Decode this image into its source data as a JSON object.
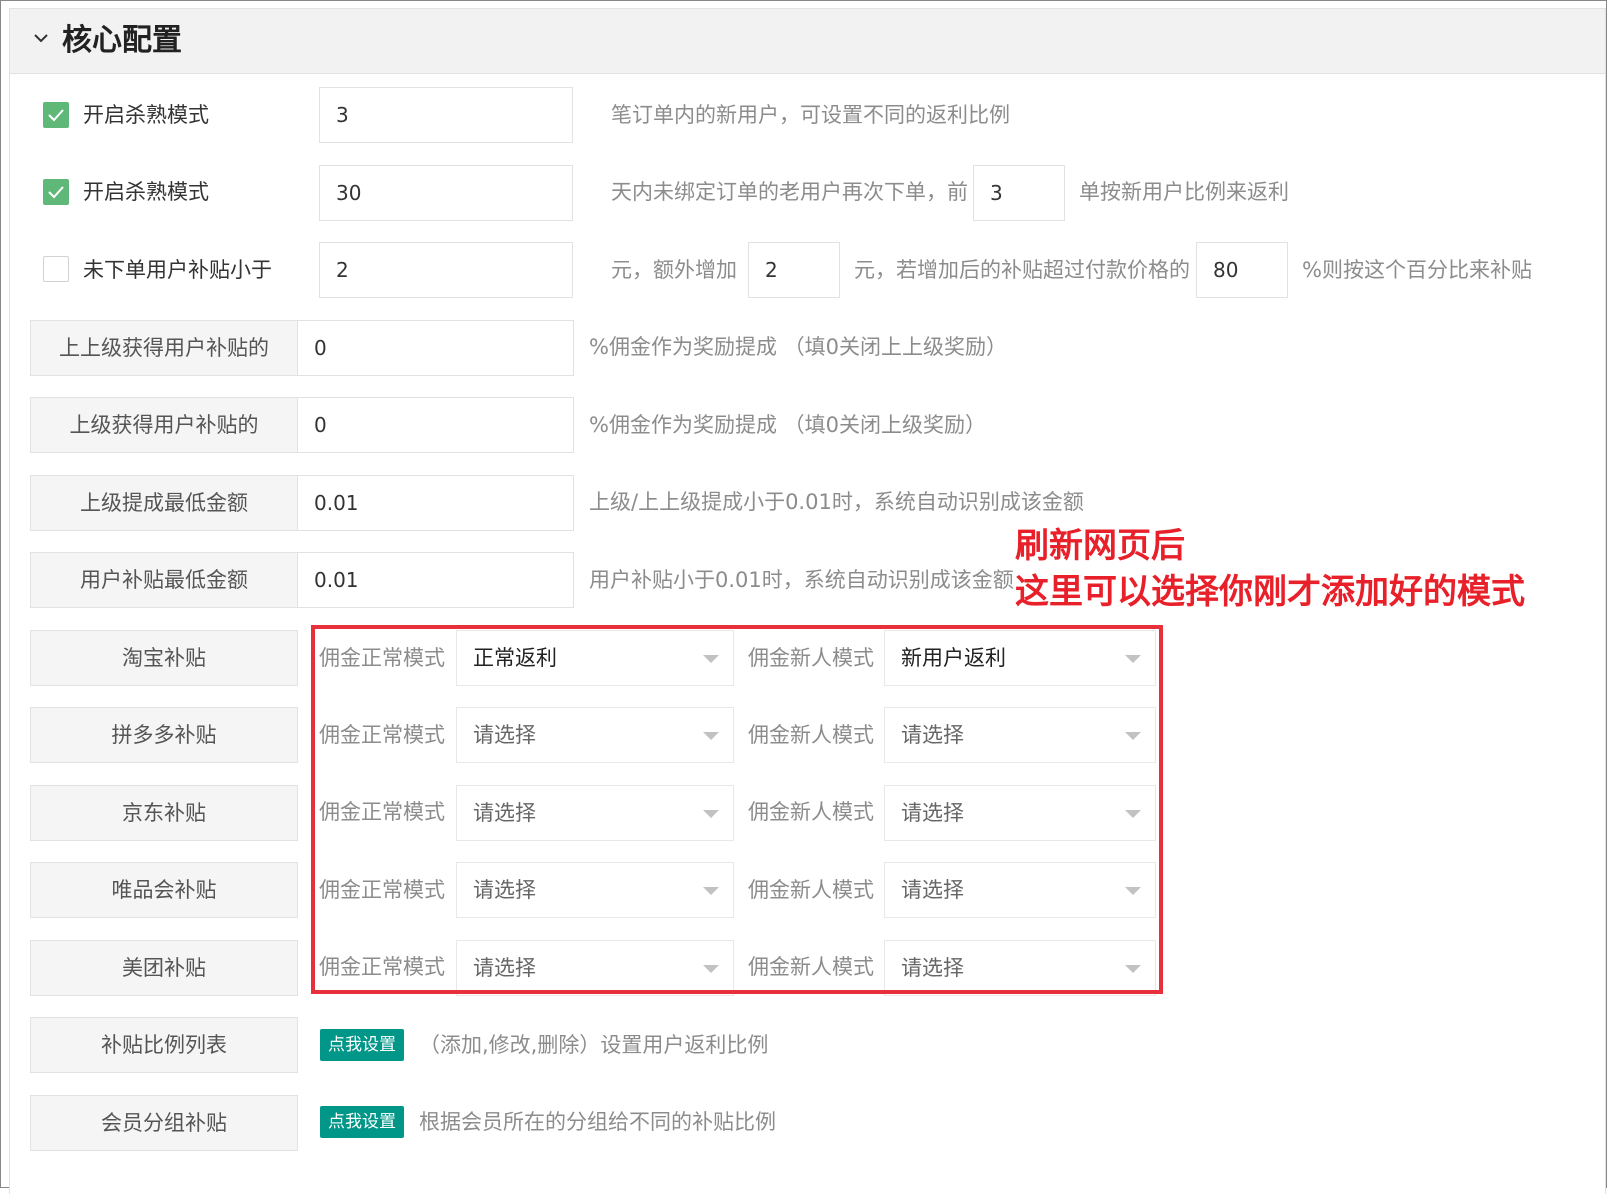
{
  "panel": {
    "title": "核心配置"
  },
  "row1": {
    "checked": true,
    "label": "开启杀熟模式",
    "value": "3",
    "desc": "笔订单内的新用户，可设置不同的返利比例"
  },
  "row2": {
    "checked": true,
    "label": "开启杀熟模式",
    "value": "30",
    "desc1": "天内未绑定订单的老用户再次下单，前",
    "value2": "3",
    "desc2": "单按新用户比例来返利"
  },
  "row3": {
    "checked": false,
    "label": "未下单用户补贴小于",
    "value": "2",
    "desc1": "元，额外增加",
    "value2": "2",
    "desc2": "元，若增加后的补贴超过付款价格的",
    "value3": "80",
    "desc3": "%则按这个百分比来补贴"
  },
  "fields": [
    {
      "label": "上上级获得用户补贴的",
      "value": "0",
      "desc": "%佣金作为奖励提成 （填0关闭上上级奖励）"
    },
    {
      "label": "上级获得用户补贴的",
      "value": "0",
      "desc": "%佣金作为奖励提成 （填0关闭上级奖励）"
    },
    {
      "label": "上级提成最低金额",
      "value": "0.01",
      "desc": "上级/上上级提成小于0.01时，系统自动识别成该金额"
    },
    {
      "label": "用户补贴最低金额",
      "value": "0.01",
      "desc": "用户补贴小于0.01时，系统自动识别成该金额"
    }
  ],
  "platforms": [
    {
      "label": "淘宝补贴",
      "normal_label": "佣金正常模式",
      "normal_value": "正常返利",
      "normal_set": true,
      "new_label": "佣金新人模式",
      "new_value": "新用户返利",
      "new_set": true
    },
    {
      "label": "拼多多补贴",
      "normal_label": "佣金正常模式",
      "normal_value": "请选择",
      "normal_set": false,
      "new_label": "佣金新人模式",
      "new_value": "请选择",
      "new_set": false
    },
    {
      "label": "京东补贴",
      "normal_label": "佣金正常模式",
      "normal_value": "请选择",
      "normal_set": false,
      "new_label": "佣金新人模式",
      "new_value": "请选择",
      "new_set": false
    },
    {
      "label": "唯品会补贴",
      "normal_label": "佣金正常模式",
      "normal_value": "请选择",
      "normal_set": false,
      "new_label": "佣金新人模式",
      "new_value": "请选择",
      "new_set": false
    },
    {
      "label": "美团补贴",
      "normal_label": "佣金正常模式",
      "normal_value": "请选择",
      "normal_set": false,
      "new_label": "佣金新人模式",
      "new_value": "请选择",
      "new_set": false
    }
  ],
  "links": [
    {
      "label": "补贴比例列表",
      "button": "点我设置",
      "desc": "（添加,修改,删除）设置用户返利比例"
    },
    {
      "label": "会员分组补贴",
      "button": "点我设置",
      "desc": "根据会员所在的分组给不同的补贴比例"
    }
  ],
  "annotation": {
    "line1": "刷新网页后",
    "line2": "这里可以选择你刚才添加好的模式",
    "color": "#e8202a"
  },
  "colors": {
    "check_green": "#5fb878",
    "button_teal": "#009688",
    "highlight_red": "#e8303a"
  }
}
